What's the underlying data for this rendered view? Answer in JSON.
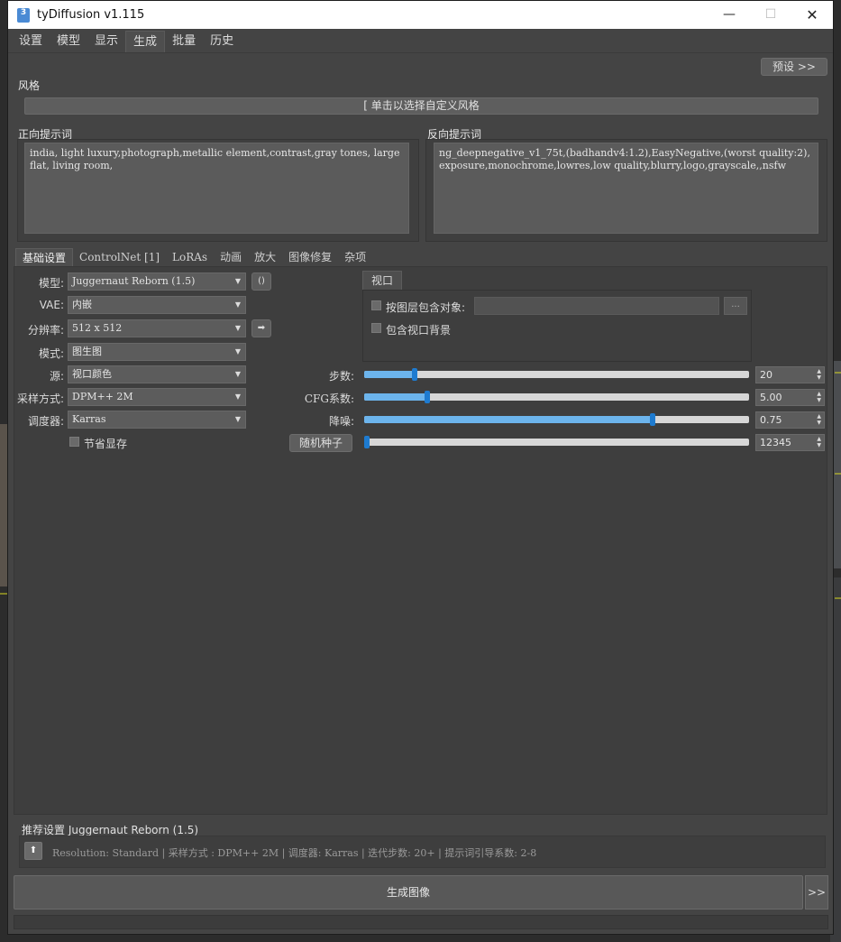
{
  "window": {
    "app_icon": "3",
    "title": "tyDiffusion v1.115",
    "min": "—",
    "max": "☐",
    "close": "✕"
  },
  "menu": [
    "设置",
    "模型",
    "显示",
    "生成",
    "批量",
    "历史"
  ],
  "menu_active": "生成",
  "preset_label": "预设 >>",
  "style": {
    "label": "风格",
    "button": "[ 单击以选择自定义风格"
  },
  "positive": {
    "label": "正向提示词",
    "text": "india, light luxury,photograph,metallic element,contrast,gray tones, large flat, living room,"
  },
  "negative": {
    "label": "反向提示词",
    "text": "ng_deepnegative_v1_75t,(badhandv4:1.2),EasyNegative,(worst quality:2),exposure,monochrome,lowres,low quality,blurry,logo,grayscale,,nsfw"
  },
  "sub_tabs": [
    "基础设置",
    "ControlNet [1]",
    "LoRAs",
    "动画",
    "放大",
    "图像修复",
    "杂项"
  ],
  "sub_tab_active": "基础设置",
  "fields": {
    "model": {
      "label": "模型:",
      "value": "Juggernaut Reborn (1.5)"
    },
    "vae": {
      "label": "VAE:",
      "value": "内嵌"
    },
    "resolution": {
      "label": "分辨率:",
      "value": "512 x 512"
    },
    "mode": {
      "label": "模式:",
      "value": "图生图"
    },
    "source": {
      "label": "源:",
      "value": "视口颜色"
    },
    "sampler": {
      "label": "采样方式:",
      "value": "DPM++ 2M"
    },
    "scheduler": {
      "label": "调度器:",
      "value": "Karras"
    },
    "save_vram": {
      "label": "节省显存",
      "checked": false
    }
  },
  "model_refresh_icon": "()",
  "resolution_arrow_icon": "➡",
  "viewport": {
    "tab": "视口",
    "include_layer": {
      "label": "按图层包含对象:",
      "checked": false
    },
    "dots": "...",
    "include_bg": {
      "label": "包含视口背景",
      "checked": false
    }
  },
  "sliders": {
    "steps": {
      "label": "步数:",
      "value": "20",
      "fraction": 0.13
    },
    "cfg": {
      "label": "CFG系数:",
      "value": "5.00",
      "fraction": 0.165
    },
    "denoise": {
      "label": "降噪:",
      "value": "0.75",
      "fraction": 0.75
    },
    "seed": {
      "label": "随机种子",
      "value": "12345",
      "fraction": 0.0
    }
  },
  "recommend": {
    "title": "推荐设置 Juggernaut Reborn (1.5)",
    "text": "Resolution: Standard | 采样方式 : DPM++ 2M | 调度器: Karras | 迭代步数: 20+ | 提示词引导系数: 2-8",
    "icon": "⬆"
  },
  "generate": {
    "label": "生成图像",
    "more": ">>"
  },
  "colors": {
    "slider_fill": "#6cb4ec",
    "slider_handle": "#1e7bd0"
  }
}
